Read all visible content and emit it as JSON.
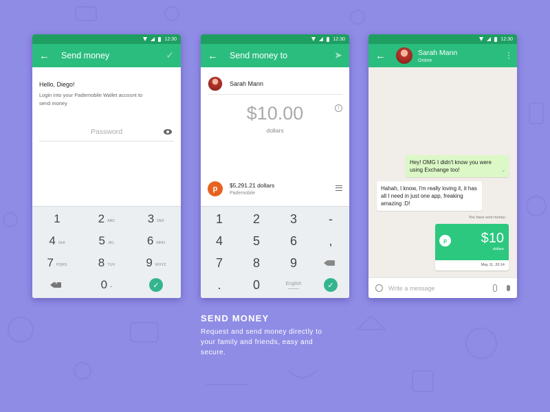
{
  "status_bar": {
    "time": "12:30"
  },
  "screen1": {
    "title": "Send money",
    "greeting": "Hello, Diego!",
    "instruction": "Login into your Pademobile Wallet account to send money",
    "password_placeholder": "Password",
    "keypad": [
      [
        {
          "n": "1",
          "l": ""
        },
        {
          "n": "2",
          "l": "ABC"
        },
        {
          "n": "3",
          "l": "DEF"
        }
      ],
      [
        {
          "n": "4",
          "l": "GHI"
        },
        {
          "n": "5",
          "l": "JKL"
        },
        {
          "n": "6",
          "l": "MNO"
        }
      ],
      [
        {
          "n": "7",
          "l": "PQRS"
        },
        {
          "n": "8",
          "l": "TUV"
        },
        {
          "n": "9",
          "l": "WXYZ"
        }
      ],
      [
        {
          "n": "",
          "l": ""
        },
        {
          "n": "0",
          "l": "+"
        },
        {
          "n": "",
          "l": ""
        }
      ]
    ]
  },
  "screen2": {
    "title": "Send money to",
    "recipient": "Sarah Mann",
    "amount": "$10.00",
    "unit": "dollars",
    "wallet_balance": "$5,291.21 dollars",
    "wallet_name": "Pademobile",
    "wallet_badge": "p",
    "keypad": [
      [
        "1",
        "2",
        "3",
        "-"
      ],
      [
        "4",
        "5",
        "6",
        ","
      ],
      [
        "7",
        "8",
        "9",
        ""
      ],
      [
        ".",
        "0",
        "English",
        ""
      ]
    ]
  },
  "screen3": {
    "contact": "Sarah Mann",
    "status": "Online",
    "msg_out": "Hey! OMG I didn't know you were using Exchange too!",
    "msg_in": "Hahah, I know, I'm really loving it, it has all I need in just one app, freaking amazing :D!",
    "sent_label": "You have sent money:",
    "card_badge": "p",
    "card_amount": "$10",
    "card_unit": "dollars",
    "card_date": "May 11, 20:14",
    "composer_placeholder": "Write a message"
  },
  "caption": {
    "title": "SEND MONEY",
    "text": "Request and send money directly to your family and friends, easy and secure."
  },
  "colors": {
    "background": "#8f8ce6",
    "appbar": "#2bbd7e",
    "statusbar": "#1f9e62",
    "accent": "#35b58d"
  }
}
